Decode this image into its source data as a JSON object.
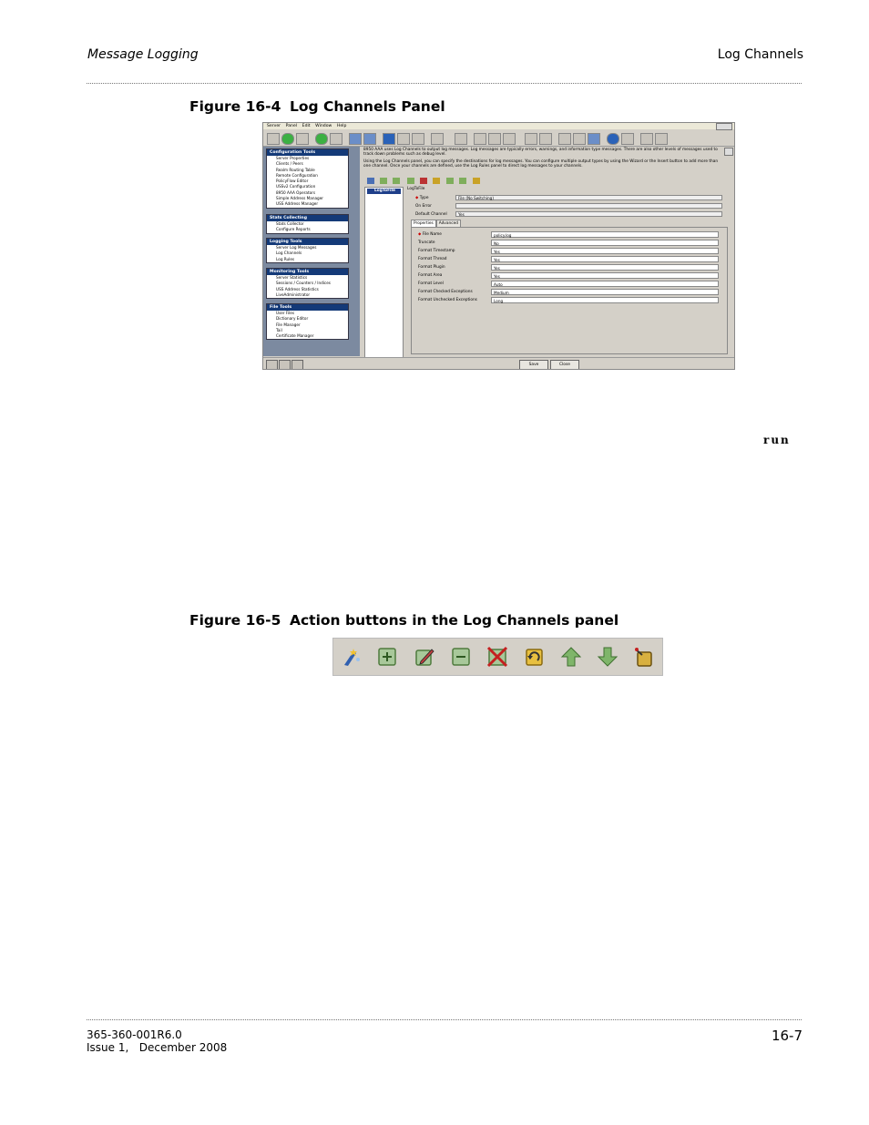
{
  "header": {
    "left": "Message Logging",
    "right": "Log Channels"
  },
  "figure1": {
    "caption_num": "Figure 16-4",
    "caption_title": "Log Channels Panel",
    "screenshot": {
      "menu": [
        "Server",
        "Panel",
        "Edit",
        "Window",
        "Help"
      ],
      "groups": [
        {
          "title": "Configuration Tools",
          "items": [
            "Server Properties",
            "Clients / Peers",
            "Realm Routing Table",
            "Remote Configuration",
            "PolicyFlow Editor",
            "USSv2 Configuration",
            "8950 AAA Operators",
            "Simple Address Manager",
            "USS Address Manager"
          ]
        },
        {
          "title": "Stats Collecting",
          "items": [
            "Stats Collector",
            "Configure Reports"
          ]
        },
        {
          "title": "Logging Tools",
          "items": [
            "Server Log Messages",
            "Log Channels",
            "Log Rules"
          ]
        },
        {
          "title": "Monitoring Tools",
          "items": [
            "Server Statistics",
            "Sessions / Counters / Indices",
            "USS Address Statistics",
            "LiveAdministrator"
          ]
        },
        {
          "title": "File Tools",
          "items": [
            "User Files",
            "Dictionary Editor",
            "File Manager",
            "Tail",
            "Certificate Manager"
          ]
        }
      ],
      "description_p1": "8950 AAA uses Log Channels to output log messages. Log messages are typically errors, warnings, and information type messages. There are also other levels of messages used to track down problems such as debug level.",
      "description_p2": "Using the Log Channels panel, you can specify the destinations for log messages. You can configure multiple output types by using the Wizard or the Insert button to add more than one channel. Once your channels are defined, use the Log Rules panel to direct log messages to your channels.",
      "tree_node": "LogToFile",
      "detail_title": "LogToFile",
      "fields": [
        {
          "label": "Type",
          "value": "File (No Switching)",
          "required": true
        },
        {
          "label": "On Error",
          "value": "",
          "required": false
        },
        {
          "label": "Default Channel",
          "value": "Yes",
          "required": false
        }
      ],
      "tabs": [
        "Properties",
        "Advanced"
      ],
      "properties": [
        {
          "label": "File Name",
          "value": "policy.log",
          "required": true
        },
        {
          "label": "Truncate",
          "value": "No",
          "required": false
        },
        {
          "label": "Format Timestamp",
          "value": "Yes",
          "required": false
        },
        {
          "label": "Format Thread",
          "value": "Yes",
          "required": false
        },
        {
          "label": "Format Plugin",
          "value": "Yes",
          "required": false
        },
        {
          "label": "Format Area",
          "value": "Yes",
          "required": false
        },
        {
          "label": "Format Level",
          "value": "Auto",
          "required": false
        },
        {
          "label": "Format Checked Exceptions",
          "value": "Medium",
          "required": false
        },
        {
          "label": "Format Unchecked Exceptions",
          "value": "Long",
          "required": false
        }
      ],
      "save_label": "Save",
      "close_label": "Close"
    }
  },
  "run_text": "run",
  "figure2": {
    "caption_num": "Figure 16-5",
    "caption_title": "Action buttons in the Log Channels panel",
    "buttons": [
      "wizard-icon",
      "insert-icon",
      "edit-icon",
      "remove-icon",
      "delete-icon",
      "refresh-icon",
      "move-up-icon",
      "move-down-icon",
      "test-icon"
    ]
  },
  "footer": {
    "doc_number": "365-360-001R6.0",
    "issue": "Issue 1,   December 2008",
    "page": "16-7"
  },
  "colors": {
    "sidebar_title": "#143a78",
    "panel_bg": "#d4d0c8",
    "tree_select": "#1f3f8a"
  }
}
